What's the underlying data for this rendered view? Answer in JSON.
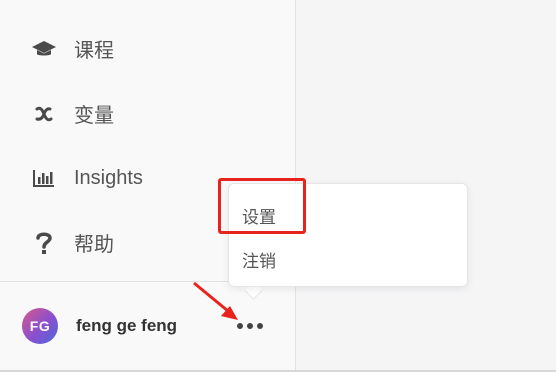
{
  "sidebar": {
    "items": [
      {
        "label": "课程",
        "icon": "graduation-cap-icon"
      },
      {
        "label": "变量",
        "icon": "variable-x-icon"
      },
      {
        "label": "Insights",
        "icon": "bar-chart-icon"
      },
      {
        "label": "帮助",
        "icon": "question-mark-icon"
      }
    ]
  },
  "user": {
    "initials": "FG",
    "name": "feng ge feng"
  },
  "menu": {
    "items": [
      {
        "label": "设置"
      },
      {
        "label": "注销"
      }
    ]
  },
  "colors": {
    "highlight": "#e8231d",
    "avatar_gradient": [
      "#d65a8a",
      "#8a4fd0",
      "#4a6ad8"
    ]
  }
}
